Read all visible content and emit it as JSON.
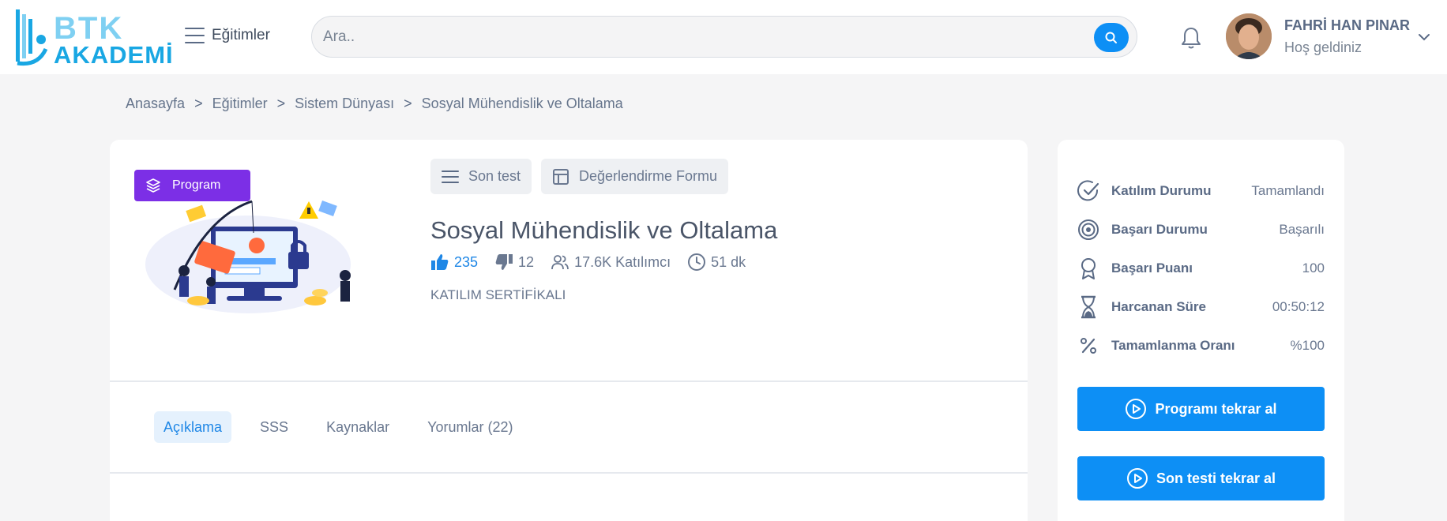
{
  "header": {
    "logo_top": "BTK",
    "logo_bottom": "AKADEMİ",
    "menu_label": "Eğitimler",
    "search_placeholder": "Ara..",
    "user_name": "FAHRİ HAN PINAR",
    "user_greeting": "Hoş geldiniz"
  },
  "breadcrumb": [
    "Anasayfa",
    "Eğitimler",
    "Sistem Dünyası",
    "Sosyal Mühendislik ve Oltalama"
  ],
  "breadcrumb_separator": ">",
  "course": {
    "badge": "Program",
    "title": "Sosyal Mühendislik ve Oltalama",
    "top_buttons": {
      "final_test": "Son test",
      "evaluation": "Değerlendirme Formu"
    },
    "likes": "235",
    "dislikes": "12",
    "participants": "17.6K Katılımcı",
    "duration": "51 dk",
    "certificate": "KATILIM SERTİFİKALI"
  },
  "tabs": [
    {
      "label": "Açıklama",
      "active": true
    },
    {
      "label": "SSS",
      "active": false
    },
    {
      "label": "Kaynaklar",
      "active": false
    },
    {
      "label": "Yorumlar (22)",
      "active": false
    }
  ],
  "status": [
    {
      "icon": "check-circle-icon",
      "label": "Katılım Durumu",
      "value": "Tamamlandı"
    },
    {
      "icon": "target-icon",
      "label": "Başarı Durumu",
      "value": "Başarılı"
    },
    {
      "icon": "award-icon",
      "label": "Başarı Puanı",
      "value": "100"
    },
    {
      "icon": "hourglass-icon",
      "label": "Harcanan Süre",
      "value": "00:50:12"
    },
    {
      "icon": "percent-icon",
      "label": "Tamamlanma Oranı",
      "value": "%100"
    }
  ],
  "actions": {
    "retake_program": "Programı tekrar al",
    "retake_final_test": "Son testi tekrar al"
  },
  "colors": {
    "primary": "#0d8ff5",
    "badge_purple": "#7c2fe6",
    "like_blue": "#1f87e6",
    "logo_light": "#7fd0f2",
    "logo_dark": "#19a7e3"
  }
}
